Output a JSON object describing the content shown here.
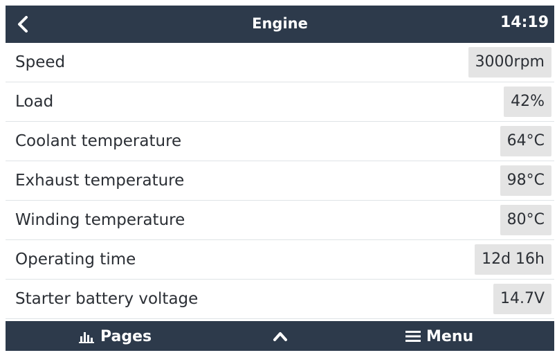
{
  "header": {
    "title": "Engine",
    "time": "14:19"
  },
  "rows": [
    {
      "label": "Speed",
      "value": "3000rpm"
    },
    {
      "label": "Load",
      "value": "42%"
    },
    {
      "label": "Coolant temperature",
      "value": "64°C"
    },
    {
      "label": "Exhaust temperature",
      "value": "98°C"
    },
    {
      "label": "Winding temperature",
      "value": "80°C"
    },
    {
      "label": "Operating time",
      "value": "12d 16h"
    },
    {
      "label": "Starter battery voltage",
      "value": "14.7V"
    }
  ],
  "footer": {
    "pages_label": "Pages",
    "menu_label": "Menu"
  },
  "colors": {
    "bar_bg": "#2d3a4b",
    "value_bg": "#e4e4e4"
  },
  "icons": {
    "back": "chevron-left-icon",
    "pages": "bar-chart-icon",
    "up": "chevron-up-icon",
    "menu": "hamburger-menu-icon"
  }
}
